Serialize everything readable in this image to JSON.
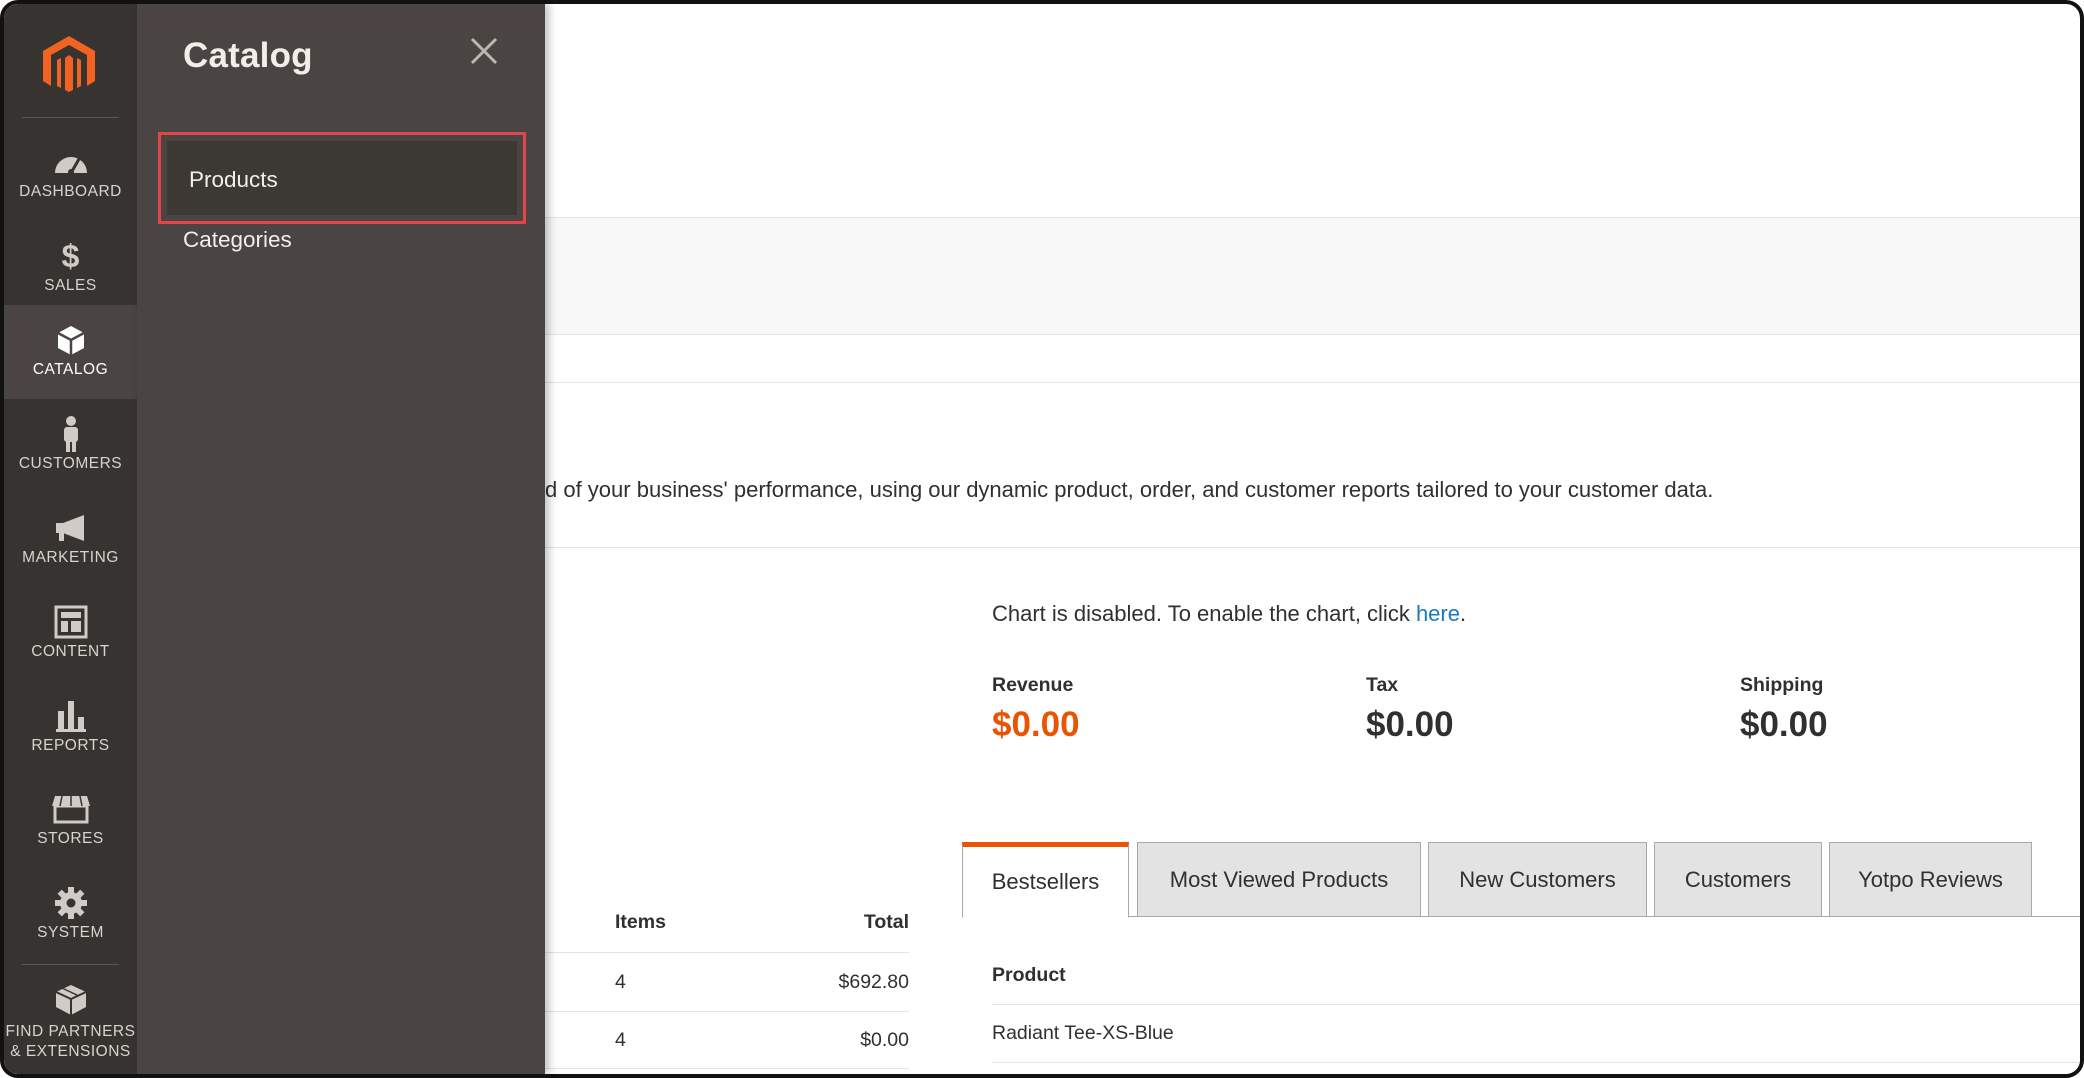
{
  "nav": {
    "items": [
      {
        "label": "DASHBOARD",
        "icon": "dashboard-icon"
      },
      {
        "label": "SALES",
        "icon": "dollar-icon"
      },
      {
        "label": "CATALOG",
        "icon": "box-icon",
        "active": true
      },
      {
        "label": "CUSTOMERS",
        "icon": "person-icon"
      },
      {
        "label": "MARKETING",
        "icon": "megaphone-icon"
      },
      {
        "label": "CONTENT",
        "icon": "layout-icon"
      },
      {
        "label": "REPORTS",
        "icon": "bar-chart-icon"
      },
      {
        "label": "STORES",
        "icon": "storefront-icon"
      },
      {
        "label": "SYSTEM",
        "icon": "gear-icon"
      }
    ],
    "partners_line1": "FIND PARTNERS",
    "partners_line2": "& EXTENSIONS"
  },
  "flyout": {
    "title": "Catalog",
    "items": [
      "Products",
      "Categories"
    ]
  },
  "main": {
    "intro": "d of your business' performance, using our dynamic product, order, and customer reports tailored to your customer data.",
    "chart_msg_prefix": "Chart is disabled. To enable the chart, click ",
    "chart_msg_link": "here",
    "chart_msg_suffix": ".",
    "totals": [
      {
        "label": "Revenue",
        "value": "$0.00"
      },
      {
        "label": "Tax",
        "value": "$0.00"
      },
      {
        "label": "Shipping",
        "value": "$0.00"
      }
    ],
    "orders_table": {
      "headers": [
        "Items",
        "Total"
      ],
      "rows": [
        [
          "4",
          "$692.80"
        ],
        [
          "4",
          "$0.00"
        ]
      ]
    },
    "tabs": [
      "Bestsellers",
      "Most Viewed Products",
      "New Customers",
      "Customers",
      "Yotpo Reviews"
    ],
    "active_tab": "Bestsellers",
    "bestsellers": {
      "header": "Product",
      "rows": [
        "Radiant Tee-XS-Blue"
      ]
    }
  },
  "colors": {
    "nav_bg": "#373330",
    "flyout_bg": "#4a4542",
    "accent": "#eb5202",
    "highlight_border": "#e2454a",
    "link": "#1979c3"
  }
}
